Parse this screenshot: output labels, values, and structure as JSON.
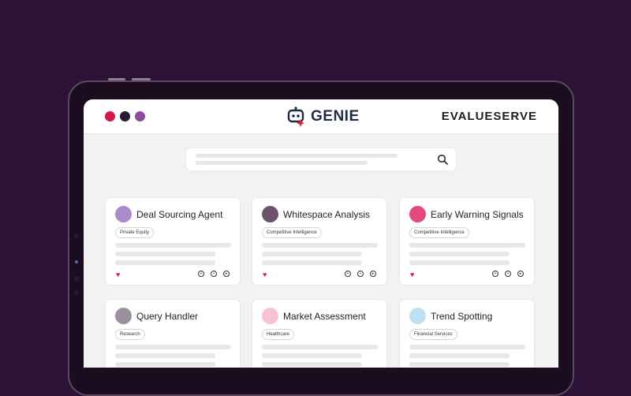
{
  "app": {
    "name": "GENIE",
    "brand": "EVALUESERVE"
  },
  "window_dots": [
    "#d6174a",
    "#2b1a33",
    "#8e4a9e"
  ],
  "search": {
    "placeholder": ""
  },
  "cards": [
    {
      "title": "Deal Sourcing Agent",
      "tag": "Private Equity",
      "avatar_color": "#a98bc7"
    },
    {
      "title": "Whitespace Analysis",
      "tag": "Competitive Intelligence",
      "avatar_color": "#6d5370"
    },
    {
      "title": "Early Warning Signals",
      "tag": "Competitive Intelligence",
      "avatar_color": "#e24a7c"
    },
    {
      "title": "Query Handler",
      "tag": "Research",
      "avatar_color": "#9c90a0"
    },
    {
      "title": "Market Assessment",
      "tag": "Healthcare",
      "avatar_color": "#f5c3d2"
    },
    {
      "title": "Trend Spotting",
      "tag": "Financial Services",
      "avatar_color": "#bfe0f2"
    }
  ],
  "icons": {
    "favorite": "heart-icon",
    "search": "search-icon",
    "actions": [
      "add-icon",
      "settings-icon",
      "play-icon"
    ]
  },
  "colors": {
    "background": "#2d1237",
    "favorite": "#d61a4a",
    "logo": "#1f2a44",
    "spark": "#e0203e"
  }
}
